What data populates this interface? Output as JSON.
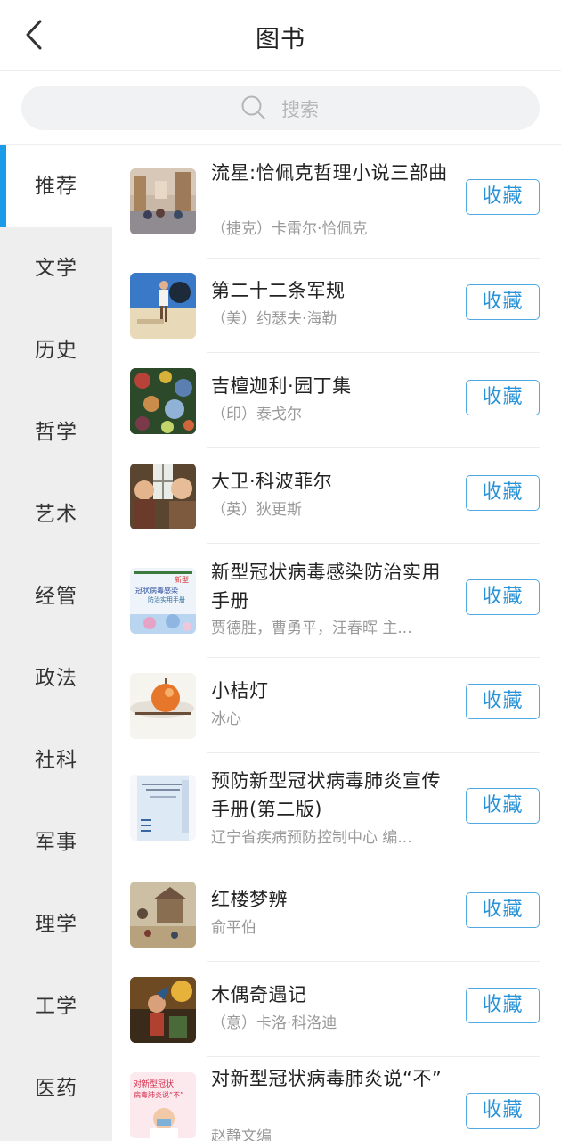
{
  "header": {
    "title": "图书"
  },
  "search": {
    "placeholder": "搜索"
  },
  "categories": [
    {
      "label": "推荐",
      "active": true
    },
    {
      "label": "文学"
    },
    {
      "label": "历史"
    },
    {
      "label": "哲学"
    },
    {
      "label": "艺术"
    },
    {
      "label": "经管"
    },
    {
      "label": "政法"
    },
    {
      "label": "社科"
    },
    {
      "label": "军事"
    },
    {
      "label": "理学"
    },
    {
      "label": "工学"
    },
    {
      "label": "医药"
    }
  ],
  "books": [
    {
      "title": "流星:恰佩克哲理小说三部曲",
      "author": "（捷克）卡雷尔·恰佩克",
      "button": "收藏"
    },
    {
      "title": "第二十二条军规",
      "author": "（美）约瑟夫·海勒",
      "button": "收藏"
    },
    {
      "title": "吉檀迦利·园丁集",
      "author": "（印）泰戈尔",
      "button": "收藏"
    },
    {
      "title": "大卫·科波菲尔",
      "author": "（英）狄更斯",
      "button": "收藏"
    },
    {
      "title": "新型冠状病毒感染防治实用手册",
      "author": "贾德胜，曹勇平，汪春晖 主...",
      "button": "收藏"
    },
    {
      "title": "小桔灯",
      "author": "冰心",
      "button": "收藏"
    },
    {
      "title": "预防新型冠状病毒肺炎宣传手册(第二版)",
      "author": "辽宁省疾病预防控制中心 编...",
      "button": "收藏"
    },
    {
      "title": "红楼梦辨",
      "author": "俞平伯",
      "button": "收藏"
    },
    {
      "title": "木偶奇遇记",
      "author": "（意）卡洛·科洛迪",
      "button": "收藏"
    },
    {
      "title": "对新型冠状病毒肺炎说“不”",
      "author": "赵静文编",
      "button": "收藏"
    }
  ],
  "covers": {
    "c4": {
      "line1": "新型",
      "line2": "冠状病毒感染",
      "line3": "防治实用手册"
    },
    "c9": {
      "line1": "对新型冠状",
      "line2": "病毒肺炎说“不”"
    }
  }
}
